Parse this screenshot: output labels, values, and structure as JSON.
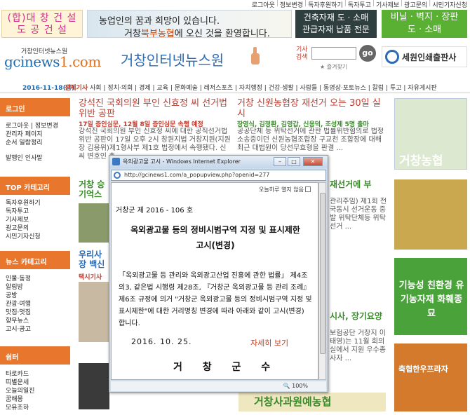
{
  "top_links": [
    "로그아웃",
    "정보변경",
    "독자후원하기",
    "독자투고",
    "기사제보",
    "광고문의",
    "시민기자신청"
  ],
  "banners": {
    "left": {
      "line1": "(합)대 창 건 설",
      "line2": "도 공 건 설"
    },
    "center": {
      "line1": "농업인의 꿈과 희망이 있습니다.",
      "line2_prefix": "거창",
      "line2_highlight": "북부농협",
      "line2_suffix": "에 오신 것을 환영합니다."
    },
    "right1": {
      "line1": "건축자재 도 · 소매",
      "line2": "관급자재 납품 전문"
    },
    "right2": {
      "line1": "비닐 · 벽지 · 장판",
      "line2": "도 · 소매"
    }
  },
  "logo": {
    "small": "거창인터넷뉴스원",
    "big_prefix": "gcinews",
    "big_suffix": "1.com"
  },
  "site_title": "거창인터넷뉴스원",
  "search": {
    "label": "기사검색",
    "button": "go",
    "favorite": "즐겨찾기"
  },
  "printer_ad": "세원인쇄출판사",
  "nav": {
    "date": "2016-11-18(금)",
    "hot": "전체기사",
    "items": [
      "사회",
      "정치·의회",
      "경제",
      "교육",
      "문화예술",
      "레저스포츠",
      "자치행정",
      "건강·생활",
      "사람들",
      "동영상·포토뉴스",
      "칼럼",
      "투고",
      "자유게시판"
    ]
  },
  "sidebar": {
    "login": {
      "title": "로그인",
      "items": [
        "로그아웃 | 정보변경",
        "관리자 페이지",
        "순서 일람정리",
        "발행인 인사말"
      ]
    },
    "top": {
      "title": "TOP 카테고리",
      "items": [
        "독자후원하기",
        "독자투고",
        "기사제보",
        "광고문의",
        "시민기자신청"
      ]
    },
    "news": {
      "title": "뉴스 카테고리",
      "items": [
        "인물·동정",
        "알림방",
        "공방",
        "관광·여행",
        "맛집·멋집",
        "향우뉴스",
        "고시·공고"
      ]
    },
    "rest": {
      "title": "쉼터",
      "items": [
        "타로카드",
        "띠별운세",
        "오늘의일진",
        "꿈해몽",
        "모유조하"
      ]
    }
  },
  "news": {
    "a": {
      "title": "강석진 국회의원 부인 신효정 씨 선거법 위반 공판",
      "meta": "17일 증인심문, 12월 8일 증인심문 속행 예정",
      "body": "강석진 국회의원 부인 신효정 씨에 대한 공직선거법 위반 공판이 17일 오후 2시 창원지법 거창지원(지원장 김용위)제1형사부 제1호 법정에서 속행됐다. 신 씨 변호인 측 ..."
    },
    "b": {
      "title": "거창 신원농협장 재선거 오는 30일 실시",
      "meta": "장영식, 김정환, 김영갑, 신용덕, 조성제 5명 출마",
      "body": "공공단체 등 위탁선거에 관한 법률위반혐의로 법정소송중이던 신원농협조합장 구교천 조합장에 대해 최근 대법원이 당선무효형을 판결 ..."
    },
    "c_title": "거창 승",
    "c_sub": "기억스",
    "d_title": "우리사",
    "d_sub": "장 백신",
    "d_sub2": "택시기사",
    "e_title": "재선거에 부",
    "e_body": "관리주임) 제1회 전국동시 선거운동 중 발 위탁단체등 위탁선거 ...",
    "f_title": "시사, 장기요양",
    "f_body": "보험공단 거창지 이태영)는 11월 회의실에서 지원 우수종사자 ...",
    "bottom_green": "거창사과원예농협"
  },
  "right_ads": [
    "거창농협",
    "기능성 친환경 유기농자재 화훼종묘",
    "축협한우프라자"
  ],
  "popup": {
    "window_title": "옥외광고물 고시 - Windows Internet Explorer",
    "url": "http://gcinews1.com/a_popupview.php?openid=277",
    "no_show": "오늘하루 열지 않음",
    "notice_number": "거창군 제 2016 - 106 호",
    "title_line1": "옥외광고물 등의 정비시범구역 지정 및 표시제한",
    "title_line2": "고시(변경)",
    "body": "「옥외광고물 등 관리와 옥외광고산업 진흥에 관한 법률」 제4조의3, 같은법 시행령 제28조, 『거창군 옥외광고물 등 관리 조례』 제6조 규정에 의거 \"거창군 옥외광고물 등의 정비시범구역 지정 및 표시제한\"에 대한 거리명칭 변경에 따라 아래와 같이 고시(변경) 합니다.",
    "date": "2016.   10.   25.",
    "more": "자세히 보기",
    "signature": "거 창 군 수",
    "zoom": "100%"
  }
}
